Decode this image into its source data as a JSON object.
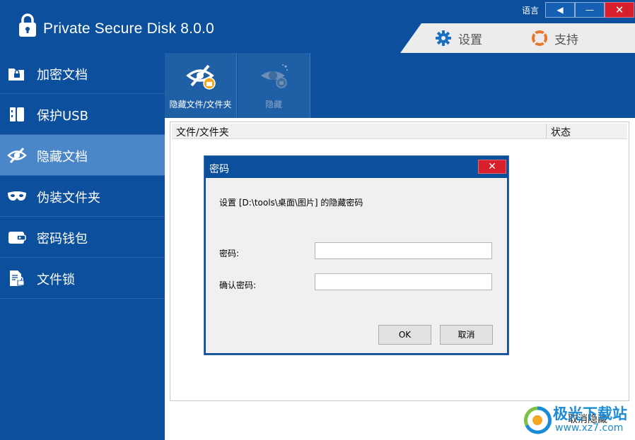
{
  "app": {
    "title": "Private Secure Disk 8.0.0",
    "language_label": "语言",
    "language_button": "◀",
    "minimize_button": "—",
    "close_button": "✕"
  },
  "top_tabs": [
    {
      "label": "设置",
      "icon": "gear-icon"
    },
    {
      "label": "支持",
      "icon": "lifebuoy-icon"
    }
  ],
  "sidebar": {
    "items": [
      {
        "label": "加密文档",
        "icon": "folder-lock-icon",
        "active": false
      },
      {
        "label": "保护USB",
        "icon": "usb-drive-icon",
        "active": false
      },
      {
        "label": "隐藏文档",
        "icon": "eye-slash-icon",
        "active": true
      },
      {
        "label": "伪装文件夹",
        "icon": "mask-icon",
        "active": false
      },
      {
        "label": "密码钱包",
        "icon": "wallet-icon",
        "active": false
      },
      {
        "label": "文件锁",
        "icon": "document-lock-icon",
        "active": false
      }
    ]
  },
  "toolbar": {
    "hide_files_label": "隐藏文件/文件夹",
    "hide_label": "隐藏"
  },
  "table": {
    "columns": [
      "文件/文件夹",
      "状态"
    ],
    "rows": []
  },
  "cancel_hide_label": "取消隐藏",
  "dialog": {
    "title": "密码",
    "message": "设置 [D:\\tools\\桌面\\图片] 的隐藏密码",
    "password_label": "密码:",
    "confirm_label": "确认密码:",
    "password_value": "",
    "confirm_value": "",
    "ok_label": "OK",
    "cancel_label": "取消",
    "close_label": "✕"
  },
  "watermark": {
    "name": "极光下载站",
    "url": "www.xz7.com"
  },
  "colors": {
    "brand_blue": "#0c4f9c",
    "active_item": "#4a86c8",
    "close_red": "#d7202b",
    "gear_blue": "#1a6fc2",
    "support_orange": "#e8772a"
  }
}
